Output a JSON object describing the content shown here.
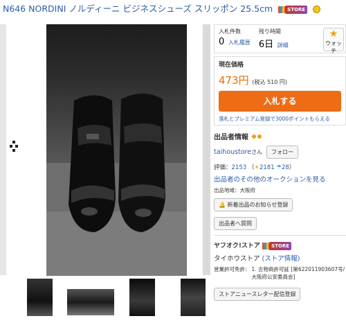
{
  "title": {
    "text": "N646 NORDINI ノルディーニ ビジネスシューズ スリッポン 25.5cm",
    "store_badge": "STORE"
  },
  "images": {
    "main_alt": "black leather monk strap shoes",
    "thumbnail_count": 4
  },
  "auction": {
    "bids_label": "入札件数",
    "bids_count": "0",
    "bid_history_link": "入札履歴",
    "time_label": "残り時間",
    "time_value": "6日",
    "time_detail_link": "詳細",
    "watch_label": "ウォッチ"
  },
  "price": {
    "label": "現在価格",
    "value": "473円",
    "tax_included": "(税込 510 円)",
    "bid_button": "入札する",
    "promo_text": "落札とプレミアム登録で3000ポイントもらえる"
  },
  "seller": {
    "heading": "出品者情報",
    "name": "taihoustore",
    "name_suffix": "さん",
    "follow_button": "フォロー",
    "rating_label": "評価：",
    "rating_total": "2153",
    "rating_good": "2181",
    "rating_bad": "28",
    "other_auctions_link": "出品者のその他のオークションを見る",
    "location": "出品地域：大阪府",
    "notify_button": "新着出品のお知らせ登録",
    "question_button": "出品者へ質問"
  },
  "store": {
    "heading": "ヤフオク!ストア",
    "store_badge": "STORE",
    "store_name": "タイホウストア",
    "store_info_link": "(ストア情報)",
    "license_label": "営業許可免許：",
    "license_value": "1. 古物商許可証 [第622011903607号/大阪府公安委員会]",
    "newsletter_button": "ストアニュースレター配信登録"
  },
  "colors": {
    "link": "#2a5ca8",
    "price": "#e86e00",
    "bid_button": "#ee6c15"
  }
}
